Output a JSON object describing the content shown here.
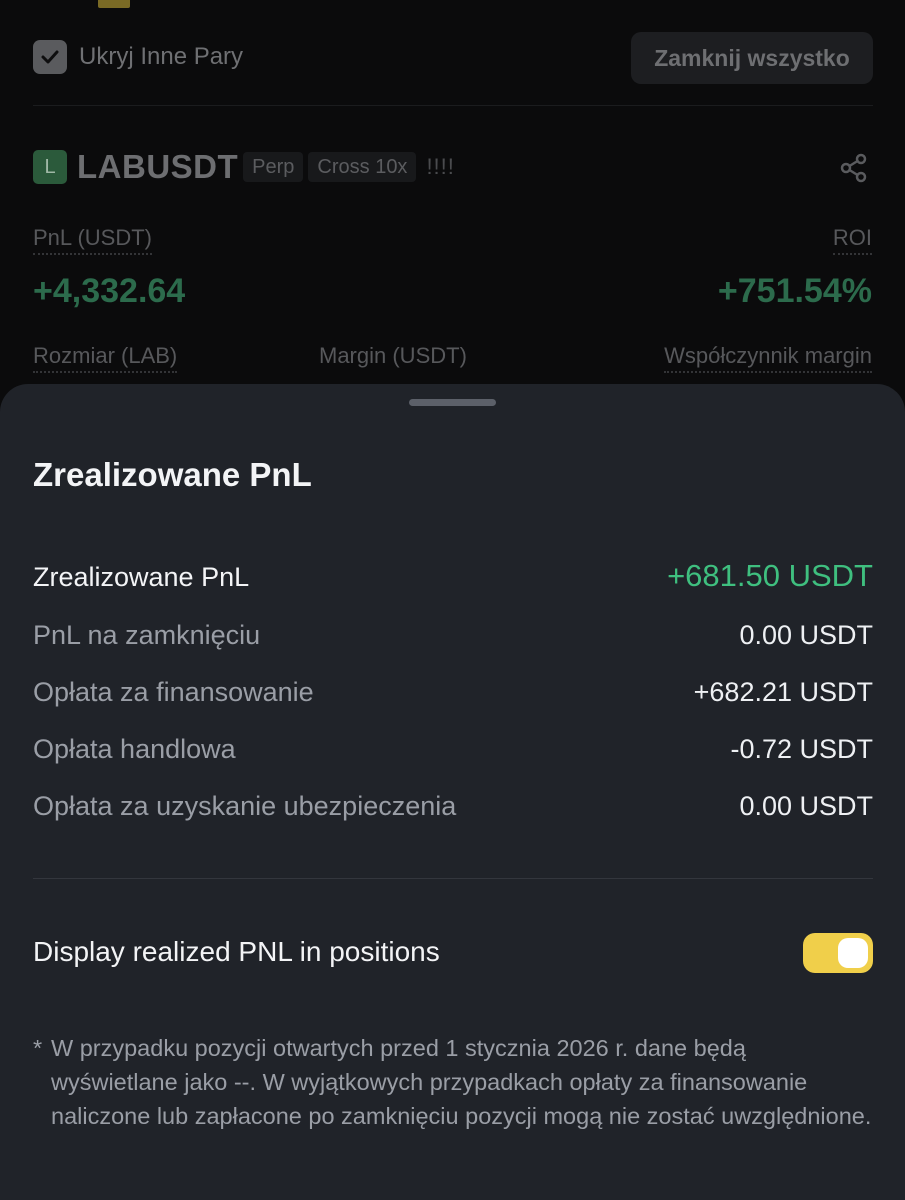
{
  "background": {
    "hide_other_pairs_label": "Ukryj Inne Pary",
    "close_all_label": "Zamknij wszystko",
    "symbol": {
      "logo_letter": "L",
      "name": "LABUSDT",
      "tag_perp": "Perp",
      "tag_margin": "Cross 10x",
      "warning": "!!!!"
    },
    "pnl_label": "PnL (USDT)",
    "pnl_value": "+4,332.64",
    "roi_label": "ROI",
    "roi_value": "+751.54%",
    "size_label": "Rozmiar (LAB)",
    "margin_label": "Margin (USDT)",
    "margin_ratio_label": "Współczynnik margin"
  },
  "sheet": {
    "title": "Zrealizowane PnL",
    "rows": [
      {
        "label": "Zrealizowane PnL",
        "value": "+681.50 USDT"
      },
      {
        "label": "PnL na zamknięciu",
        "value": "0.00 USDT"
      },
      {
        "label": "Opłata za finansowanie",
        "value": "+682.21 USDT"
      },
      {
        "label": "Opłata handlowa",
        "value": "-0.72 USDT"
      },
      {
        "label": "Opłata za uzyskanie ubezpieczenia",
        "value": "0.00 USDT"
      }
    ],
    "display_toggle": {
      "label": "Display realized PNL in positions",
      "on": true
    },
    "footnote_star": "*",
    "footnote": "W przypadku pozycji otwartych przed 1 stycznia 2026 r. dane będą wyświetlane jako --. W wyjątkowych przypadkach opłaty za finansowanie naliczone lub zapłacone po zamknięciu pozycji mogą nie zostać uwzględnione."
  },
  "colors": {
    "positive": "#3fbf7f",
    "toggle_on": "#f0cf4a",
    "sheet_bg": "#202329"
  }
}
